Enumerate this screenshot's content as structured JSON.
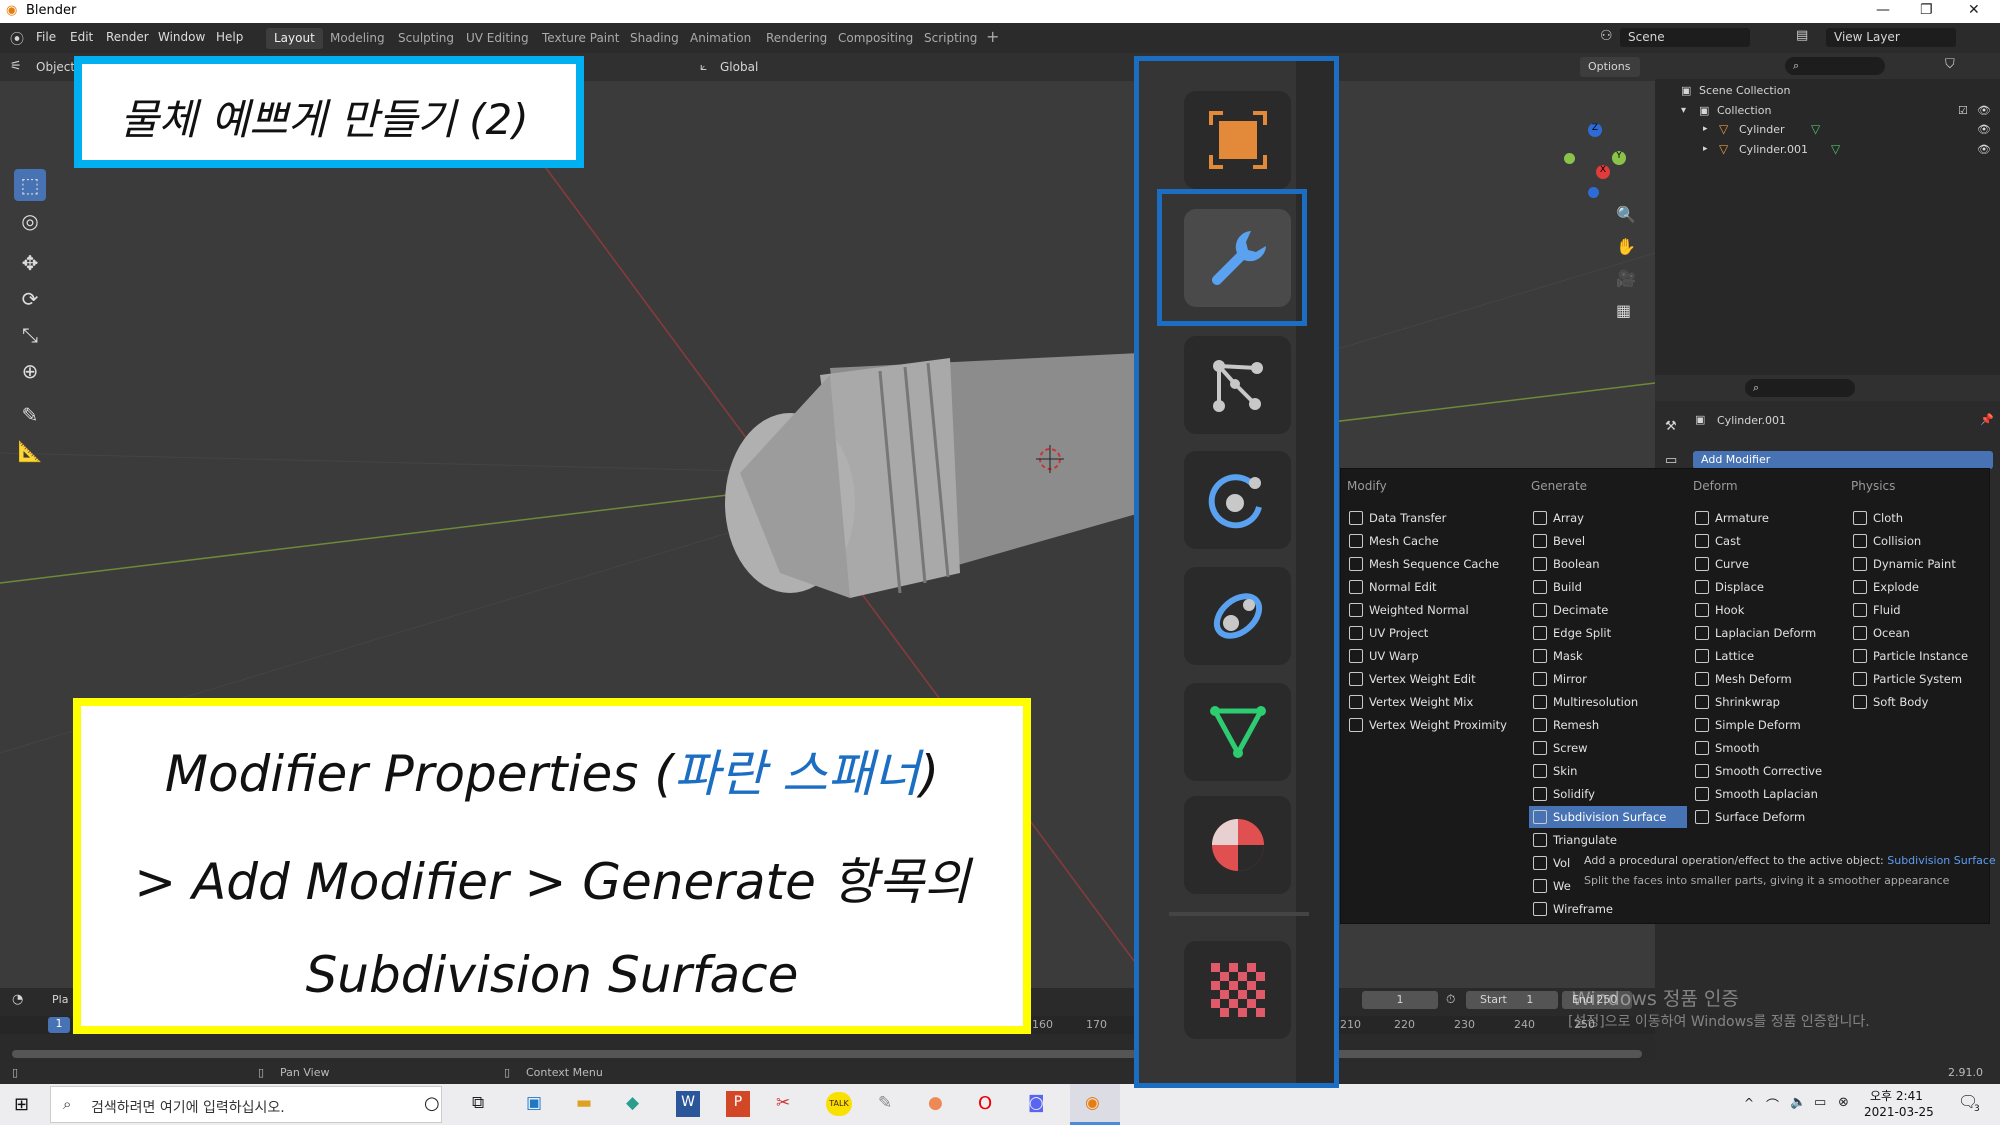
{
  "window": {
    "title": "Blender"
  },
  "menubar": {
    "items": [
      "File",
      "Edit",
      "Render",
      "Window",
      "Help"
    ],
    "workspaces": [
      "Layout",
      "Modeling",
      "Sculpting",
      "UV Editing",
      "Texture Paint",
      "Shading",
      "Animation",
      "Rendering",
      "Compositing",
      "Scripting"
    ],
    "active_workspace": "Layout",
    "scene": "Scene",
    "view_layer": "View Layer"
  },
  "viewport": {
    "mode": "Object",
    "orientation": "Global",
    "options_label": "Options"
  },
  "outliner": {
    "root": "Scene Collection",
    "collection": "Collection",
    "objects": [
      "Cylinder",
      "Cylinder.001"
    ]
  },
  "properties": {
    "object_name": "Cylinder.001",
    "add_modifier": "Add Modifier"
  },
  "modifier_menu": {
    "columns": [
      {
        "head": "Modify",
        "items": [
          "Data Transfer",
          "Mesh Cache",
          "Mesh Sequence Cache",
          "Normal Edit",
          "Weighted Normal",
          "UV Project",
          "UV Warp",
          "Vertex Weight Edit",
          "Vertex Weight Mix",
          "Vertex Weight Proximity"
        ]
      },
      {
        "head": "Generate",
        "items": [
          "Array",
          "Bevel",
          "Boolean",
          "Build",
          "Decimate",
          "Edge Split",
          "Mask",
          "Mirror",
          "Multiresolution",
          "Remesh",
          "Screw",
          "Skin",
          "Solidify",
          "Subdivision Surface",
          "Triangulate",
          "Vol",
          "We",
          "Wireframe"
        ]
      },
      {
        "head": "Deform",
        "items": [
          "Armature",
          "Cast",
          "Curve",
          "Displace",
          "Hook",
          "Laplacian Deform",
          "Lattice",
          "Mesh Deform",
          "Shrinkwrap",
          "Simple Deform",
          "Smooth",
          "Smooth Corrective",
          "Smooth Laplacian",
          "Surface Deform"
        ]
      },
      {
        "head": "Physics",
        "items": [
          "Cloth",
          "Collision",
          "Dynamic Paint",
          "Explode",
          "Fluid",
          "Ocean",
          "Particle Instance",
          "Particle System",
          "Soft Body"
        ]
      }
    ],
    "highlighted": "Subdivision Surface"
  },
  "tooltip": {
    "line1": "Add a procedural operation/effect to the active object:",
    "line1_hl": "Subdivision Surface",
    "line2": "Split the faces into smaller parts, giving it a smoother appearance"
  },
  "timeline": {
    "playback": "Pla",
    "current_frame": "1",
    "frame_field": "1",
    "start_label": "Start",
    "start_value": "1",
    "end_label": "End",
    "end_value": "250",
    "ticks": [
      "160",
      "170",
      "210",
      "220",
      "230",
      "240",
      "250"
    ]
  },
  "watermark": {
    "line1": "Windows 정품 인증",
    "line2": "[설정]으로 이동하여 Windows를 정품 인증합니다."
  },
  "statusbar": {
    "pan": "Pan View",
    "context": "Context Menu",
    "version": "2.91.0"
  },
  "taskbar": {
    "search_placeholder": "검색하려면 여기에 입력하십시오.",
    "time": "오후 2:41",
    "date": "2021-03-25",
    "notif_count": "3"
  },
  "annotations": {
    "title": "물체 예쁘게 만들기 (2)",
    "line1_a": "Modifier Properties (",
    "line1_b": "파란 스패너",
    "line1_c": ")",
    "line2": "> Add Modifier > Generate 항목의",
    "line3": "Subdivision Surface"
  },
  "colors": {
    "accent_blue": "#1b6ec2",
    "highlight": "#4772b3",
    "annot_yellow": "#ffff00",
    "annot_cyan": "#00b0f0"
  }
}
